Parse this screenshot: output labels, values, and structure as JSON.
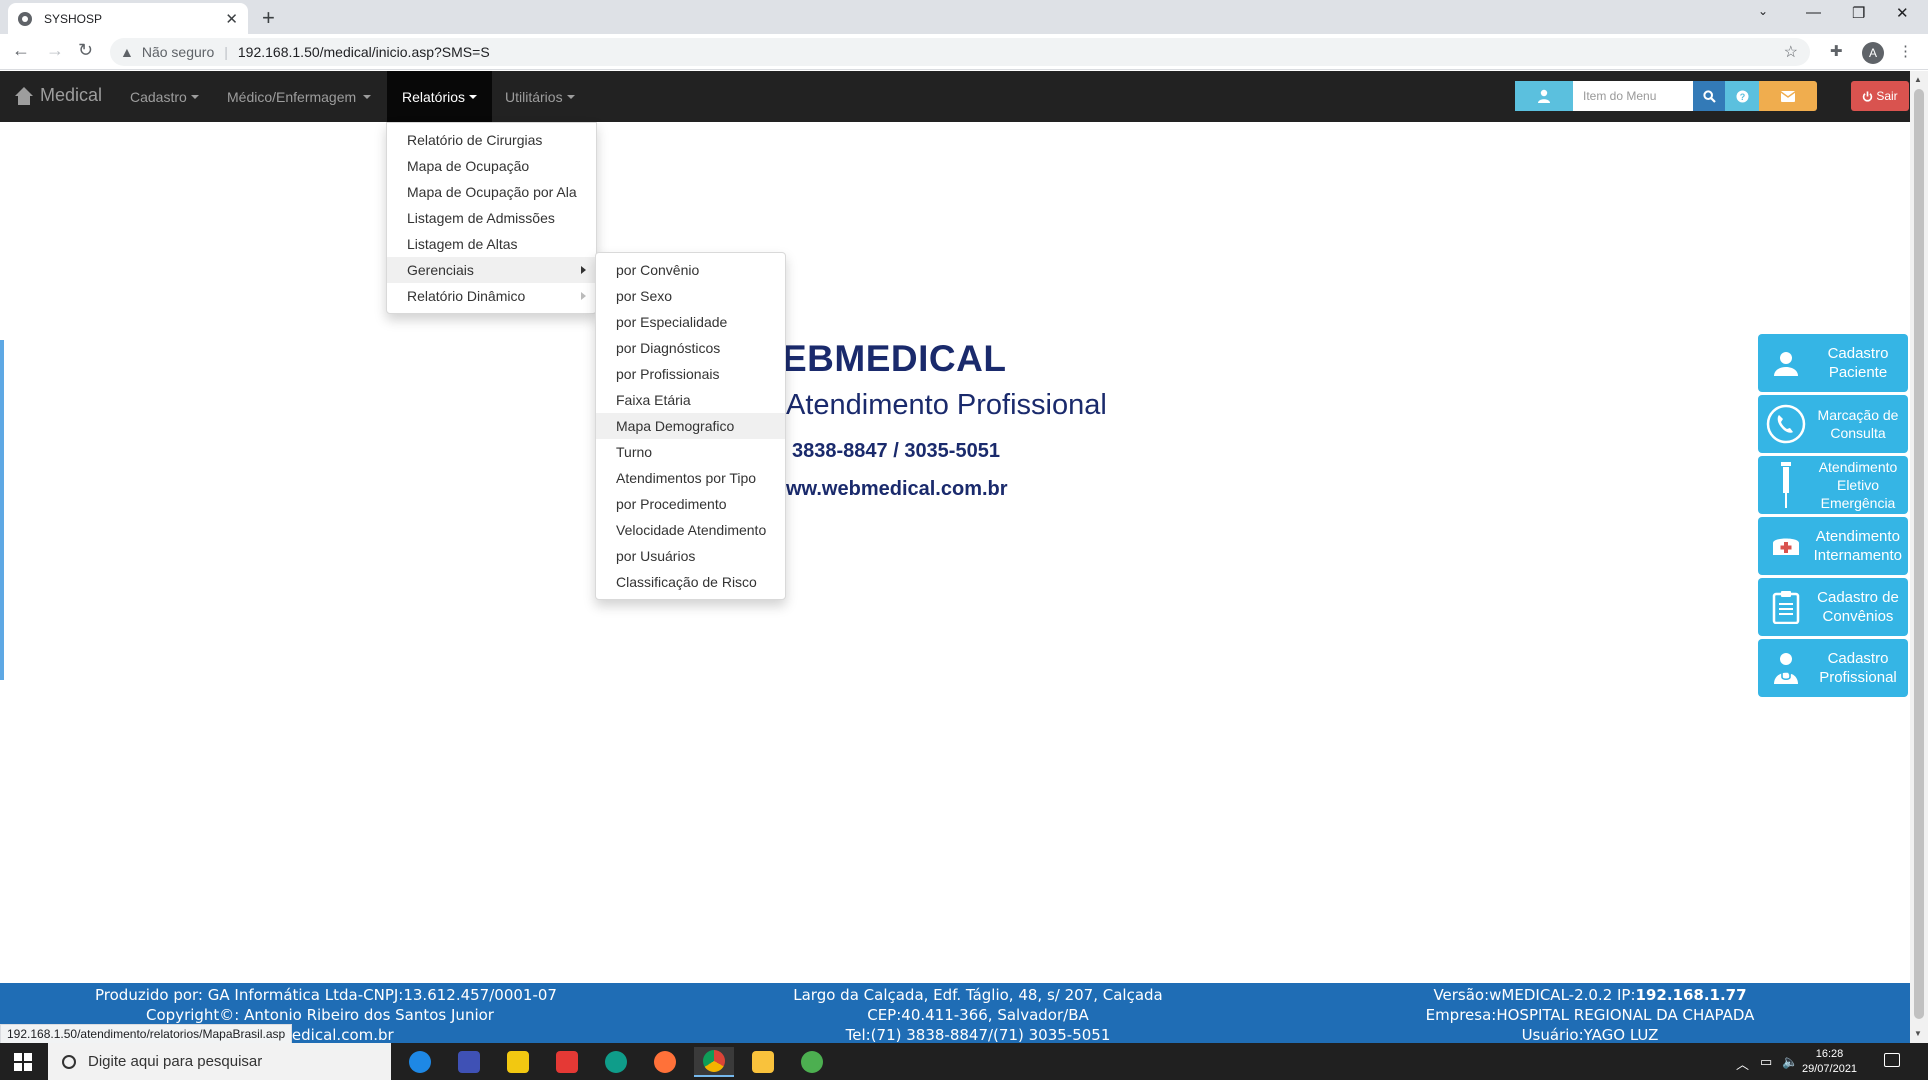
{
  "browser": {
    "tab_title": "SYSHOSP",
    "tab_close": "✕",
    "new_tab": "+",
    "security_label": "Não seguro",
    "url": "192.168.1.50/medical/inicio.asp?SMS=S",
    "profile_initial": "A",
    "status_url": "192.168.1.50/atendimento/relatorios/MapaBrasil.asp"
  },
  "navbar": {
    "brand": "Medical",
    "menus": [
      {
        "label": "Cadastro"
      },
      {
        "label": "Médico/Enfermagem"
      },
      {
        "label": "Relatórios"
      },
      {
        "label": "Utilitários"
      }
    ],
    "search_placeholder": "Item do Menu",
    "exit_label": "Sair"
  },
  "relatorios_menu": {
    "items": [
      {
        "label": "Relatório de Cirurgias"
      },
      {
        "label": "Mapa de Ocupação"
      },
      {
        "label": "Mapa de Ocupação por Ala"
      },
      {
        "label": "Listagem de Admissões"
      },
      {
        "label": "Listagem de Altas"
      },
      {
        "label": "Gerenciais"
      },
      {
        "label": "Relatório Dinâmico"
      }
    ]
  },
  "gerenciais_submenu": {
    "items": [
      {
        "label": "por Convênio"
      },
      {
        "label": "por Sexo"
      },
      {
        "label": "por Especialidade"
      },
      {
        "label": "por Diagnósticos"
      },
      {
        "label": "por Profissionais"
      },
      {
        "label": "Faixa Etária"
      },
      {
        "label": "Mapa Demografico"
      },
      {
        "label": "Turno"
      },
      {
        "label": "Atendimentos por Tipo"
      },
      {
        "label": "por Procedimento"
      },
      {
        "label": "Velocidade Atendimento"
      },
      {
        "label": "por Usuários"
      },
      {
        "label": "Classificação de Risco"
      }
    ]
  },
  "center": {
    "title": "EBMEDICAL",
    "subtitle": "Atendimento Profissional",
    "phone": "3838-8847 / 3035-5051",
    "website": "ww.webmedical.com.br"
  },
  "quick_buttons": [
    {
      "line1": "Cadastro",
      "line2": "Paciente",
      "line3": "",
      "icon": "user-icon"
    },
    {
      "line1": "Marcação de",
      "line2": "Consulta",
      "line3": "",
      "icon": "phone-icon"
    },
    {
      "line1": "Atendimento",
      "line2": "Eletivo",
      "line3": "Emergência",
      "icon": "syringe-icon"
    },
    {
      "line1": "Atendimento",
      "line2": "Internamento",
      "line3": "",
      "icon": "medical-kit-icon"
    },
    {
      "line1": "Cadastro de",
      "line2": "Convênios",
      "line3": "",
      "icon": "clipboard-icon"
    },
    {
      "line1": "Cadastro",
      "line2": "Profissional",
      "line3": "",
      "icon": "doctor-icon"
    }
  ],
  "footer": {
    "left": {
      "line1": "Produzido por: GA Informática Ltda-CNPJ:13.612.457/0001-07",
      "line2": "Copyright©: Antonio Ribeiro dos Santos Junior",
      "line3": "webmedical.com.br"
    },
    "center": {
      "line1": "Largo da Calçada, Edf. Táglio, 48, s/ 207, Calçada",
      "line2": "CEP:40.411-366, Salvador/BA",
      "line3": "Tel:(71) 3838-8847/(71) 3035-5051"
    },
    "right": {
      "version_label": "Versão:wMEDICAL-2.0.2 IP:",
      "ip": "192.168.1.77",
      "company": "Empresa:HOSPITAL REGIONAL DA CHAPADA",
      "user": "Usuário:YAGO LUZ"
    }
  },
  "taskbar": {
    "search_placeholder": "Digite aqui para pesquisar",
    "time": "16:28",
    "date": "29/07/2021"
  },
  "colors": {
    "navbar_bg": "#222222",
    "footer_bg": "#1f6db5",
    "quick_button_bg": "#35b5e5",
    "exit_button": "#d9534f",
    "center_text": "#1a2a6c"
  }
}
